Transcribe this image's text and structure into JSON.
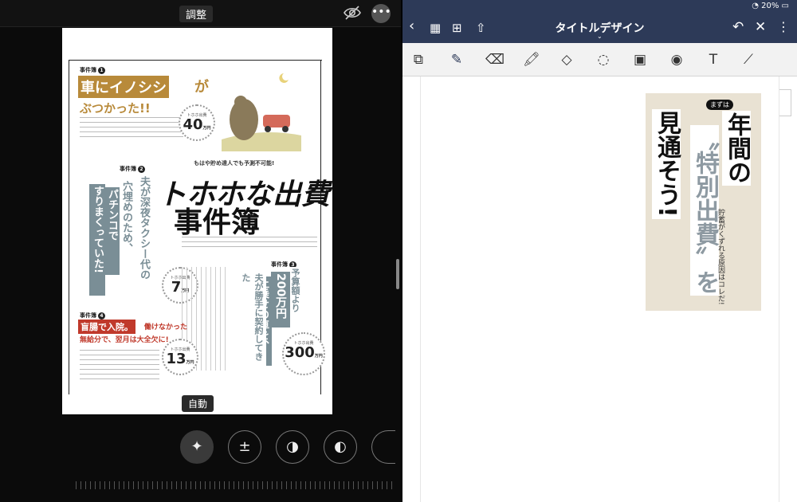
{
  "left_pane": {
    "title": "調整",
    "auto_label": "自動",
    "magazine": {
      "case1_label": "事件簿",
      "case1_num": "1",
      "case1_head_a": "車にイノシシ",
      "case1_head_b": "が",
      "case1_head_c": "ぶつかった!!",
      "case1_badge_label": "トホホ出費",
      "case1_badge_value": "40",
      "case1_badge_unit": "万円",
      "case2_label": "事件簿",
      "case2_num": "2",
      "case2_text_a": "夫が深夜タクシー代の",
      "case2_text_b": "穴埋めのため、",
      "case2_text_c": "パチンコで",
      "case2_text_d": "すりまくっていた!",
      "case2_badge_label": "トホホ出費",
      "case2_badge_value": "7",
      "case2_badge_unit": "万円",
      "title_kicker": "もはや貯め達人でも予測不可能!",
      "title_a": "トホホな出費",
      "title_b": "事件簿",
      "case3_label": "事件簿",
      "case3_num": "3",
      "case3_text_a": "予算額より",
      "case3_text_b": "200万円",
      "case3_text_c": "上乗せの車を、",
      "case3_text_d": "夫が勝手に契約してきた",
      "case3_badge_label": "トホホ出費",
      "case3_badge_value": "300",
      "case3_badge_unit": "万円",
      "case4_label": "事件簿",
      "case4_num": "4",
      "case4_head_a": "盲腸で入院。",
      "case4_head_b": "働けなかった",
      "case4_head_c": "無給分で、翌月は大全欠に!",
      "case4_badge_label": "トホホ出費",
      "case4_badge_value": "13",
      "case4_badge_unit": "万円"
    }
  },
  "right_pane": {
    "battery": "20%",
    "doc_title": "タイトルデザイン",
    "design": {
      "mazuwa": "まずは",
      "col1": "年間の",
      "col2": "〝特別出費〟を",
      "col3": "見通そう!",
      "side": "貯蓄がくずれる原因はコレだ!"
    }
  },
  "colors": {
    "nav_bg": "#2d3a58",
    "orange": "#b88a3a",
    "teal": "#7a8e96",
    "red": "#c0392b",
    "beige": "#e9e2d3"
  }
}
